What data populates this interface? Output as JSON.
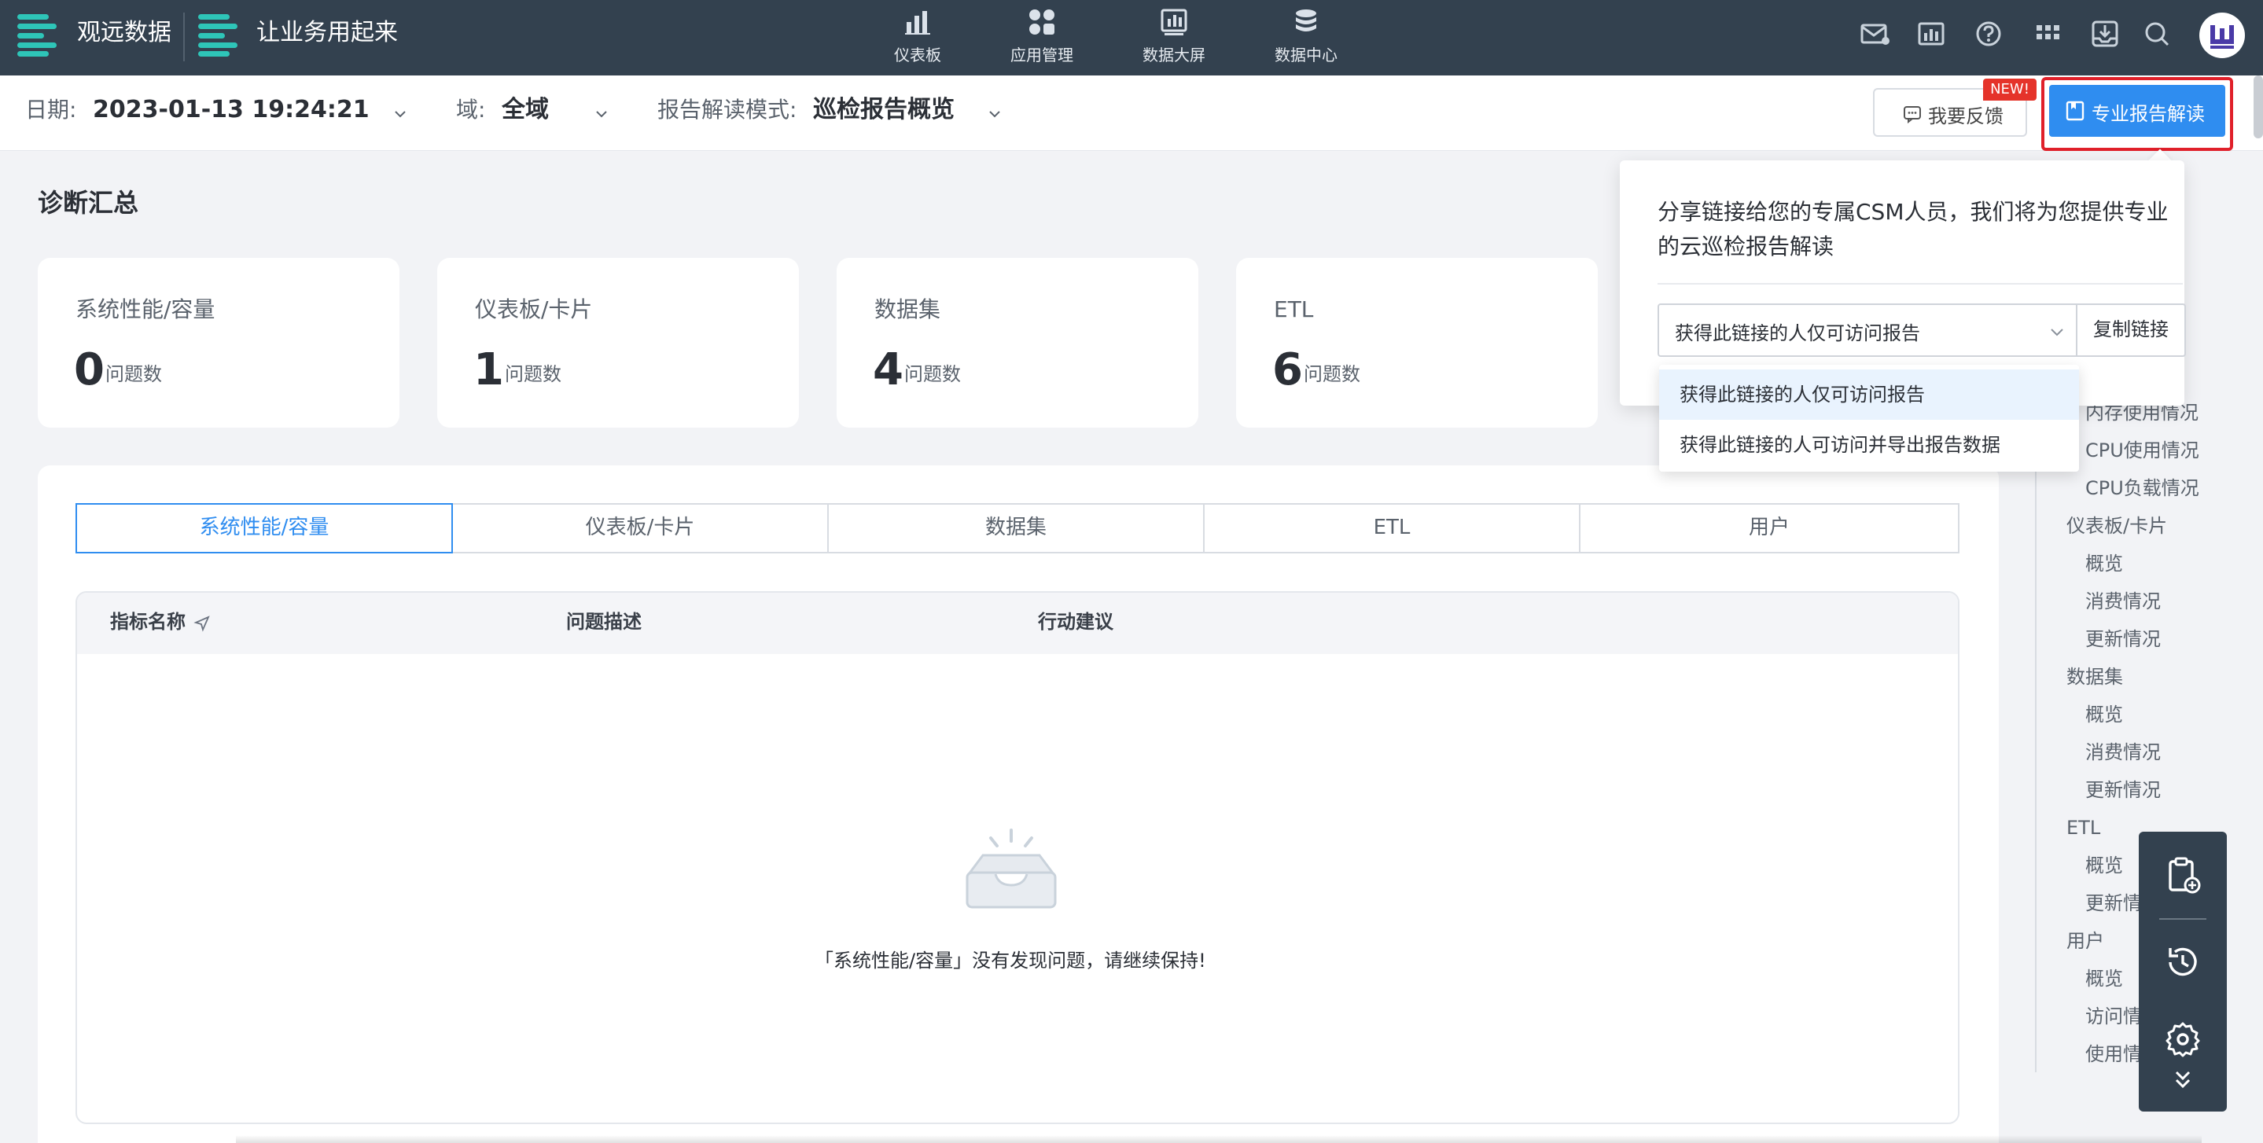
{
  "topnav": {
    "brand": "观远数据",
    "slogan": "让业务用起来",
    "items": [
      {
        "label": "仪表板",
        "icon": "bar-chart-icon"
      },
      {
        "label": "应用管理",
        "icon": "apps-grid-icon"
      },
      {
        "label": "数据大屏",
        "icon": "screen-chart-icon"
      },
      {
        "label": "数据中心",
        "icon": "database-icon"
      }
    ],
    "right_icons": [
      "mail-icon",
      "report-icon",
      "help-icon",
      "apps-icon",
      "download-tray-icon",
      "search-icon",
      "avatar-logo"
    ]
  },
  "filters": {
    "date_label": "日期:",
    "date_value": "2023-01-13 19:24:21",
    "domain_label": "域:",
    "domain_value": "全域",
    "mode_label": "报告解读模式:",
    "mode_value": "巡检报告概览"
  },
  "actions": {
    "feedback_label": "我要反馈",
    "new_badge": "NEW!",
    "pro_label": "专业报告解读"
  },
  "summary": {
    "title": "诊断汇总",
    "unit": "问题数",
    "cards": [
      {
        "label": "系统性能/容量",
        "count": "0"
      },
      {
        "label": "仪表板/卡片",
        "count": "1"
      },
      {
        "label": "数据集",
        "count": "4"
      },
      {
        "label": "ETL",
        "count": "6"
      }
    ]
  },
  "tabs": [
    "系统性能/容量",
    "仪表板/卡片",
    "数据集",
    "ETL",
    "用户"
  ],
  "active_tab": "系统性能/容量",
  "table": {
    "col_metric": "指标名称",
    "col_problem": "问题描述",
    "col_action": "行动建议",
    "empty_message": "「系统性能/容量」没有发现问题，请继续保持!"
  },
  "share_popover": {
    "description": "分享链接给您的专属CSM人员，我们将为您提供专业的云巡检报告解读",
    "selected_option": "获得此链接的人仅可访问报告",
    "copy_label": "复制链接",
    "options": [
      "获得此链接的人仅可访问报告",
      "获得此链接的人可访问并导出报告数据"
    ]
  },
  "outline": {
    "items": [
      {
        "label": "内存使用情况",
        "level": 2
      },
      {
        "label": "CPU使用情况",
        "level": 2
      },
      {
        "label": "CPU负载情况",
        "level": 2
      },
      {
        "label": "仪表板/卡片",
        "level": 1
      },
      {
        "label": "概览",
        "level": 2
      },
      {
        "label": "消费情况",
        "level": 2
      },
      {
        "label": "更新情况",
        "level": 2
      },
      {
        "label": "数据集",
        "level": 1
      },
      {
        "label": "概览",
        "level": 2
      },
      {
        "label": "消费情况",
        "level": 2
      },
      {
        "label": "更新情况",
        "level": 2
      },
      {
        "label": "ETL",
        "level": 1
      },
      {
        "label": "概览",
        "level": 2
      },
      {
        "label": "更新情况",
        "level": 2
      },
      {
        "label": "用户",
        "level": 1
      },
      {
        "label": "概览",
        "level": 2
      },
      {
        "label": "访问情况",
        "level": 2
      },
      {
        "label": "使用情况",
        "level": 2
      }
    ]
  },
  "floatbar": {
    "icons": [
      "clipboard-add-icon",
      "history-icon",
      "settings-icon",
      "collapse-down-icon"
    ]
  },
  "colors": {
    "nav_bg": "#33414f",
    "accent": "#2f8df0",
    "brand_teal": "#2ec5b8",
    "highlight_red": "#e0202a"
  }
}
